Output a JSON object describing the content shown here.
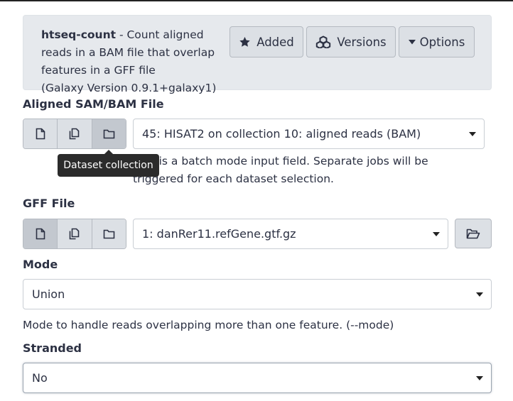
{
  "tool": {
    "name": "htseq-count",
    "description": " - Count aligned reads in a BAM file that overlap features in a GFF file ",
    "version": "(Galaxy Version 0.9.1+galaxy1)"
  },
  "header_buttons": {
    "added": "Added",
    "versions": "Versions",
    "options": "Options"
  },
  "fields": {
    "aligned": {
      "label": "Aligned SAM/BAM File",
      "value": "45: HISAT2 on collection 10: aligned reads (BAM)",
      "help_line1": "This is a batch mode input field. Separate jobs will be",
      "help_line2": "triggered for each dataset selection.",
      "tooltip": "Dataset collection"
    },
    "gff": {
      "label": "GFF File",
      "value": "1: danRer11.refGene.gtf.gz"
    },
    "mode": {
      "label": "Mode",
      "value": "Union",
      "help": "Mode to handle reads overlapping more than one feature. (--mode)"
    },
    "stranded": {
      "label": "Stranded",
      "value": "No"
    }
  },
  "colors": {
    "header_bg": "#e6e9ed",
    "button_bg": "#dce0e5",
    "button_active_bg": "#c3c8cf",
    "text": "#2c3143",
    "tooltip_bg": "#2b2b2b"
  }
}
